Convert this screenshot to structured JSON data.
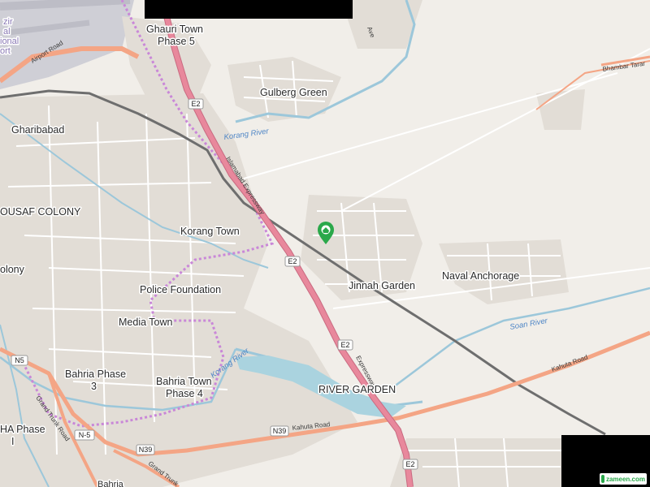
{
  "colors": {
    "land": "#f1eee9",
    "urban": "#e2ddd6",
    "street": "#ffffff",
    "street_edge": "#d2ccc4",
    "water": "#aad3df",
    "river_line": "#9cc7da",
    "expressway": "#e8889c",
    "expressway_edge": "#c96a80",
    "trunk": "#f4a585",
    "trunk_edge": "#d98b6c",
    "railway": "#6e6e6e",
    "boundary": "#c987d8",
    "pin": "#2aa84a",
    "airport": "#cfcfd6"
  },
  "labels": [
    {
      "id": "ghauri",
      "lines": [
        "Ghauri Town",
        "Phase 5"
      ]
    },
    {
      "id": "gulberg",
      "lines": [
        "Gulberg Green"
      ]
    },
    {
      "id": "gharibabad",
      "lines": [
        "Gharibabad"
      ]
    },
    {
      "id": "yousaf",
      "lines": [
        "OUSAF COLONY"
      ]
    },
    {
      "id": "korang_town",
      "lines": [
        "Korang Town"
      ]
    },
    {
      "id": "colony",
      "lines": [
        "olony"
      ]
    },
    {
      "id": "police",
      "lines": [
        "Police Foundation"
      ]
    },
    {
      "id": "media",
      "lines": [
        "Media Town"
      ]
    },
    {
      "id": "bahria3",
      "lines": [
        "Bahria Phase",
        "3"
      ]
    },
    {
      "id": "bahria4",
      "lines": [
        "Bahria Town",
        "Phase 4"
      ]
    },
    {
      "id": "jinnah",
      "lines": [
        "Jinnah Garden"
      ]
    },
    {
      "id": "naval",
      "lines": [
        "Naval Anchorage"
      ]
    },
    {
      "id": "river_garden",
      "lines": [
        "RIVER GARDEN"
      ]
    },
    {
      "id": "dha",
      "lines": [
        "HA Phase",
        "I"
      ]
    },
    {
      "id": "airport",
      "lines": [
        "zir",
        "al",
        "ional",
        "ort"
      ]
    }
  ],
  "rivers": {
    "korang_top": "Korang River",
    "korang_bottom": "Korang River",
    "soan": "Soan River"
  },
  "roads": {
    "airport_road": "Airport Road",
    "islamabad_expressway": "Islamabad Expressway",
    "expressway_lower": "Expressway",
    "kahuta_road_right": "Kahuta Road",
    "kahuta_road_lower": "Kahuta Road",
    "grand_trunk_road": "Grand Trunk Road",
    "grand_trunk_lower": "Grand Trunk",
    "bhambar": "Bhambar Tarar",
    "ave": "Ave"
  },
  "shields": {
    "e2_1": "E2",
    "e2_2": "E2",
    "e2_3": "E2",
    "e2_4": "E2",
    "n5_1": "N5",
    "n5_2": "N-5",
    "n39_1": "N39",
    "n39_2": "N39"
  },
  "partial": {
    "bahria_bottom": "Bahria"
  },
  "watermark": "zameen.com",
  "pin_icon": "location-pin-icon"
}
